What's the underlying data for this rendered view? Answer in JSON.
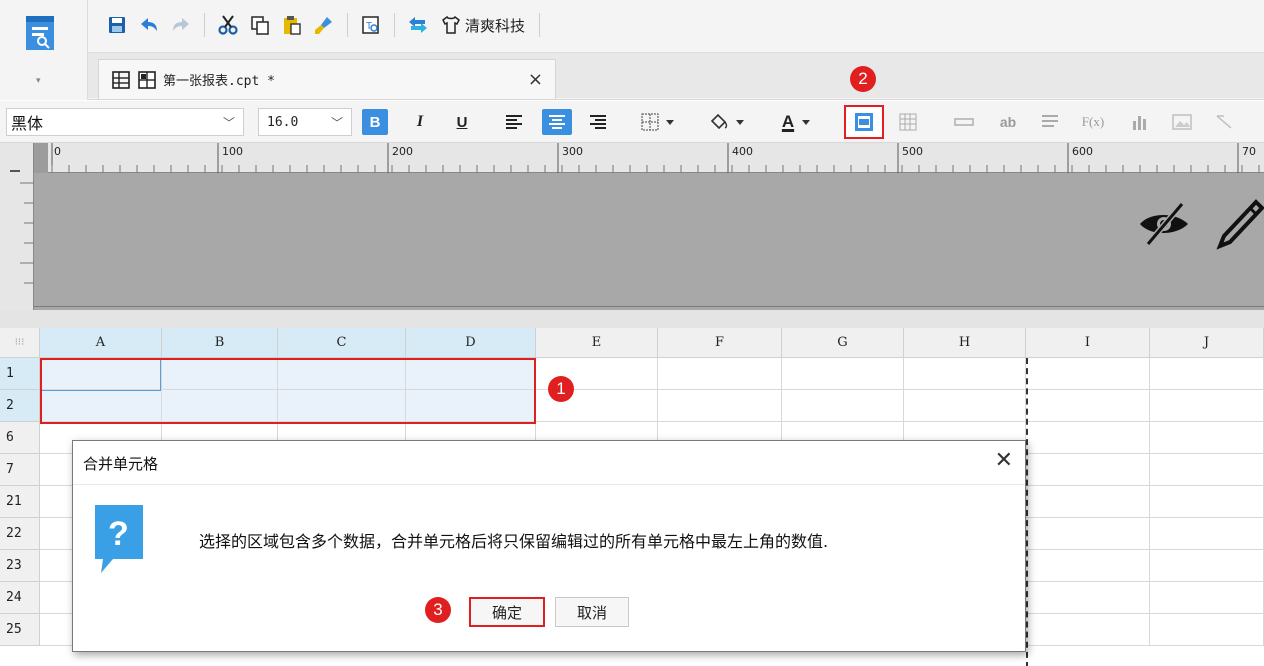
{
  "toolbar": {
    "brand_label": "清爽科技",
    "icons": [
      "save-icon",
      "undo-icon",
      "redo-icon",
      "cut-icon",
      "copy-icon",
      "paste-icon",
      "format-brush-icon",
      "preview-icon",
      "swap-icon",
      "shirt-icon"
    ]
  },
  "tab": {
    "label": "第一张报表.cpt *",
    "close": "×"
  },
  "format": {
    "font_name": "黑体",
    "font_size": "16.0",
    "bold": "B",
    "italic": "I",
    "underline": "U",
    "text_color_label": "A",
    "insert_text_label": "ab",
    "formula_label": "F(x)"
  },
  "ruler": {
    "marks": [
      "0",
      "100",
      "200",
      "300",
      "400",
      "500",
      "600",
      "70"
    ]
  },
  "grid": {
    "columns": [
      "A",
      "B",
      "C",
      "D",
      "E",
      "F",
      "G",
      "H",
      "I",
      "J"
    ],
    "rows": [
      "1",
      "2",
      "6",
      "7",
      "21",
      "22",
      "23",
      "24",
      "25"
    ],
    "selected_columns": [
      "A",
      "B",
      "C",
      "D"
    ],
    "selected_rows": [
      "1",
      "2"
    ]
  },
  "annotations": {
    "mark_1": "1",
    "mark_2": "2",
    "mark_3": "3",
    "color": "#e02020"
  },
  "dialog": {
    "title": "合并单元格",
    "close": "✕",
    "message": "选择的区域包含多个数据，合并单元格后将只保留编辑过的所有单元格中最左上角的数值.",
    "ok_label": "确定",
    "cancel_label": "取消",
    "icon": "question-icon",
    "icon_color": "#3aa0e6"
  },
  "colors": {
    "accent": "#3b8fe0",
    "selection_fill": "#e9f2fb",
    "header_selected": "#d7ebf7"
  }
}
